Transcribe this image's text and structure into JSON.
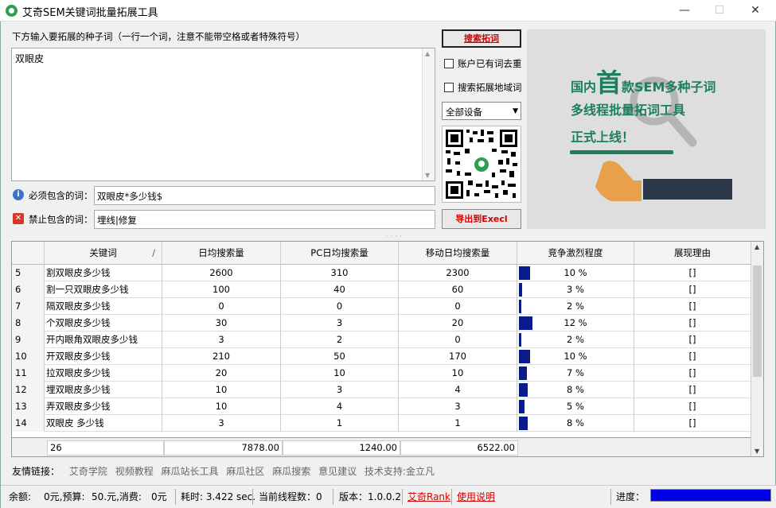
{
  "window": {
    "title": "艾奇SEM关键词批量拓展工具",
    "minimize": "—",
    "maximize": "☐",
    "close": "✕"
  },
  "input": {
    "seed_label": "下方输入要拓展的种子词（一行一个词，注意不能带空格或者特殊符号）",
    "seed_text": "双眼皮",
    "include_label": "必须包含的词：",
    "include_value": "双眼皮*多少钱$",
    "exclude_label": "禁止包含的词：",
    "exclude_value": "埋线|修复"
  },
  "controls": {
    "search_button": "搜索拓词",
    "dedupe_label": "账户已有词去重",
    "region_label": "搜索拓展地域词",
    "device_selected": "全部设备",
    "export_button": "导出到Execl"
  },
  "banner": {
    "line1_prefix": "国内",
    "line1_big": "首",
    "line1_suffix": "款SEM多种子词",
    "line2": "多线程批量拓词工具",
    "line3": "正式上线！"
  },
  "table": {
    "headers": [
      "关键词",
      "日均搜索量",
      "PC日均搜索量",
      "移动日均搜索量",
      "竞争激烈程度",
      "展现理由"
    ],
    "sort_mark": "/",
    "rows": [
      {
        "idx": "5",
        "keyword": "割双眼皮多少钱",
        "daily": "2600",
        "pc": "310",
        "mobile": "2300",
        "competition": "10 %",
        "comp_value": 10,
        "reason": "[]"
      },
      {
        "idx": "6",
        "keyword": "割一只双眼皮多少钱",
        "daily": "100",
        "pc": "40",
        "mobile": "60",
        "competition": "3 %",
        "comp_value": 3,
        "reason": "[]"
      },
      {
        "idx": "7",
        "keyword": "隔双眼皮多少钱",
        "daily": "0",
        "pc": "0",
        "mobile": "0",
        "competition": "2 %",
        "comp_value": 2,
        "reason": "[]"
      },
      {
        "idx": "8",
        "keyword": "个双眼皮多少钱",
        "daily": "30",
        "pc": "3",
        "mobile": "20",
        "competition": "12 %",
        "comp_value": 12,
        "reason": "[]"
      },
      {
        "idx": "9",
        "keyword": "开内眼角双眼皮多少钱",
        "daily": "3",
        "pc": "2",
        "mobile": "0",
        "competition": "2 %",
        "comp_value": 2,
        "reason": "[]"
      },
      {
        "idx": "10",
        "keyword": "开双眼皮多少钱",
        "daily": "210",
        "pc": "50",
        "mobile": "170",
        "competition": "10 %",
        "comp_value": 10,
        "reason": "[]"
      },
      {
        "idx": "11",
        "keyword": "拉双眼皮多少钱",
        "daily": "20",
        "pc": "10",
        "mobile": "10",
        "competition": "7 %",
        "comp_value": 7,
        "reason": "[]"
      },
      {
        "idx": "12",
        "keyword": "埋双眼皮多少钱",
        "daily": "10",
        "pc": "3",
        "mobile": "4",
        "competition": "8 %",
        "comp_value": 8,
        "reason": "[]"
      },
      {
        "idx": "13",
        "keyword": "弄双眼皮多少钱",
        "daily": "10",
        "pc": "4",
        "mobile": "3",
        "competition": "5 %",
        "comp_value": 5,
        "reason": "[]"
      },
      {
        "idx": "14",
        "keyword": "双眼皮 多少钱",
        "daily": "3",
        "pc": "1",
        "mobile": "1",
        "competition": "8 %",
        "comp_value": 8,
        "reason": "[]"
      }
    ],
    "summary": {
      "count": "26",
      "daily": "7878.00",
      "pc": "1240.00",
      "mobile": "6522.00"
    }
  },
  "links": {
    "head": "友情链接：",
    "items": [
      "艾奇学院",
      "视频教程",
      "麻瓜站长工具",
      "麻瓜社区",
      "麻瓜搜索",
      "意见建议",
      "技术支持:金立凡"
    ]
  },
  "status": {
    "balance": "余额:",
    "balance_value": "0元,预算:",
    "budget_value": "50.元,消费:",
    "spent_value": "0元",
    "elapsed": "耗时: 3.422 sec.",
    "threads": "当前线程数：0",
    "version": "版本：1.0.0.2",
    "rank_link": "艾奇Rank",
    "help_link": "使用说明",
    "progress_label": "进度：",
    "progress_value": 1.0
  },
  "colors": {
    "accent_red": "#d40000",
    "bar_blue": "#0a1c8c",
    "banner_green": "#1d7f5b",
    "progress_blue": "#0000e6"
  }
}
